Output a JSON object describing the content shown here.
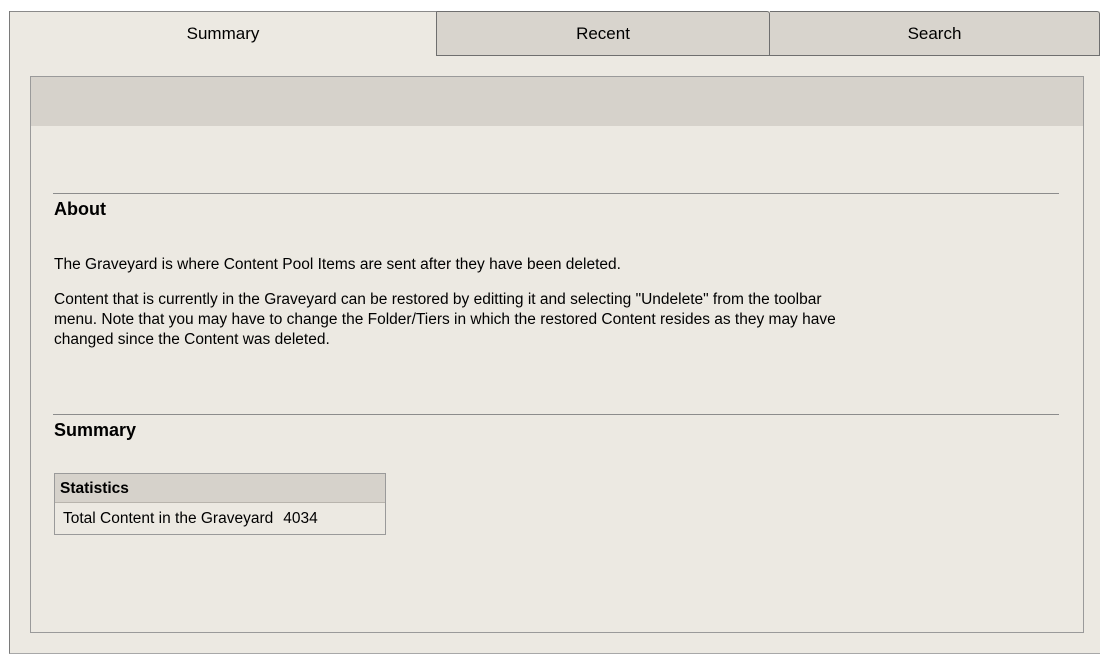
{
  "tabs": [
    {
      "label": "Summary"
    },
    {
      "label": "Recent"
    },
    {
      "label": "Search"
    }
  ],
  "about": {
    "title": "About",
    "para1": "The Graveyard is where Content Pool Items are sent after they have been deleted.",
    "para2_line1": "Content that is currently in the Graveyard can be restored by editting it and selecting \"Undelete\" from the toolbar",
    "para2_line2": "menu. Note that you may have to change the Folder/Tiers in which the restored Content resides as they may have",
    "para2_line3": "changed since the Content was deleted."
  },
  "summary": {
    "title": "Summary",
    "table_header": "Statistics",
    "rows": [
      {
        "label": "Total Content in the Graveyard",
        "value": "4034"
      }
    ]
  }
}
